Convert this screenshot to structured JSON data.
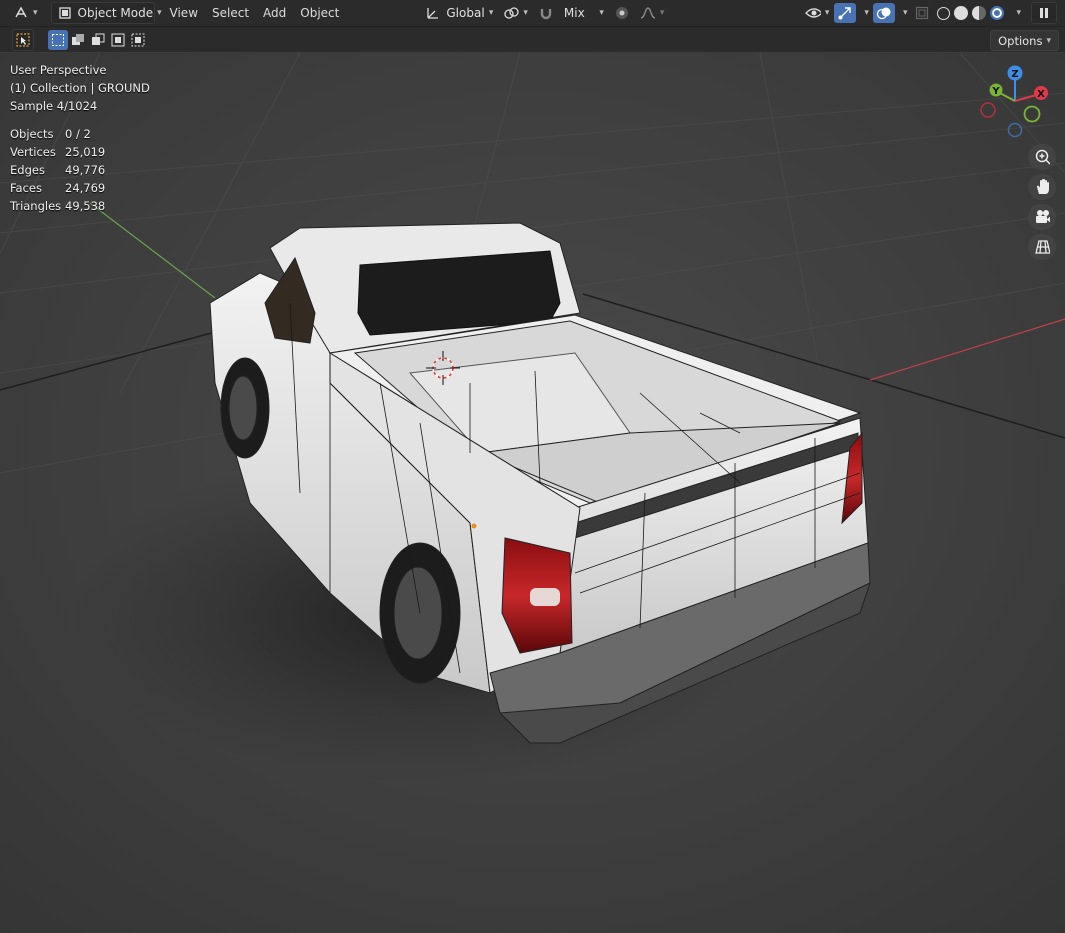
{
  "header": {
    "editor_icon": "editor-type-icon",
    "mode_label": "Object Mode",
    "menus": [
      "View",
      "Select",
      "Add",
      "Object"
    ],
    "orientation_label": "Global",
    "snap_label": "Mix",
    "pause_icon": "pause-icon"
  },
  "toolbar": {
    "options_label": "Options"
  },
  "overlay": {
    "perspective": "User Perspective",
    "collection": "(1) Collection | GROUND",
    "sample": "Sample 4/1024"
  },
  "stats": [
    {
      "label": "Objects",
      "value": "0 / 2"
    },
    {
      "label": "Vertices",
      "value": "25,019"
    },
    {
      "label": "Edges",
      "value": "49,776"
    },
    {
      "label": "Faces",
      "value": "24,769"
    },
    {
      "label": "Triangles",
      "value": "49,538"
    }
  ],
  "gizmo": {
    "x": "X",
    "y": "Y",
    "z": "Z"
  },
  "colors": {
    "x_axis": "#e0384b",
    "y_axis": "#7ab433",
    "z_axis": "#3d8ee6",
    "accent": "#4772b3"
  }
}
